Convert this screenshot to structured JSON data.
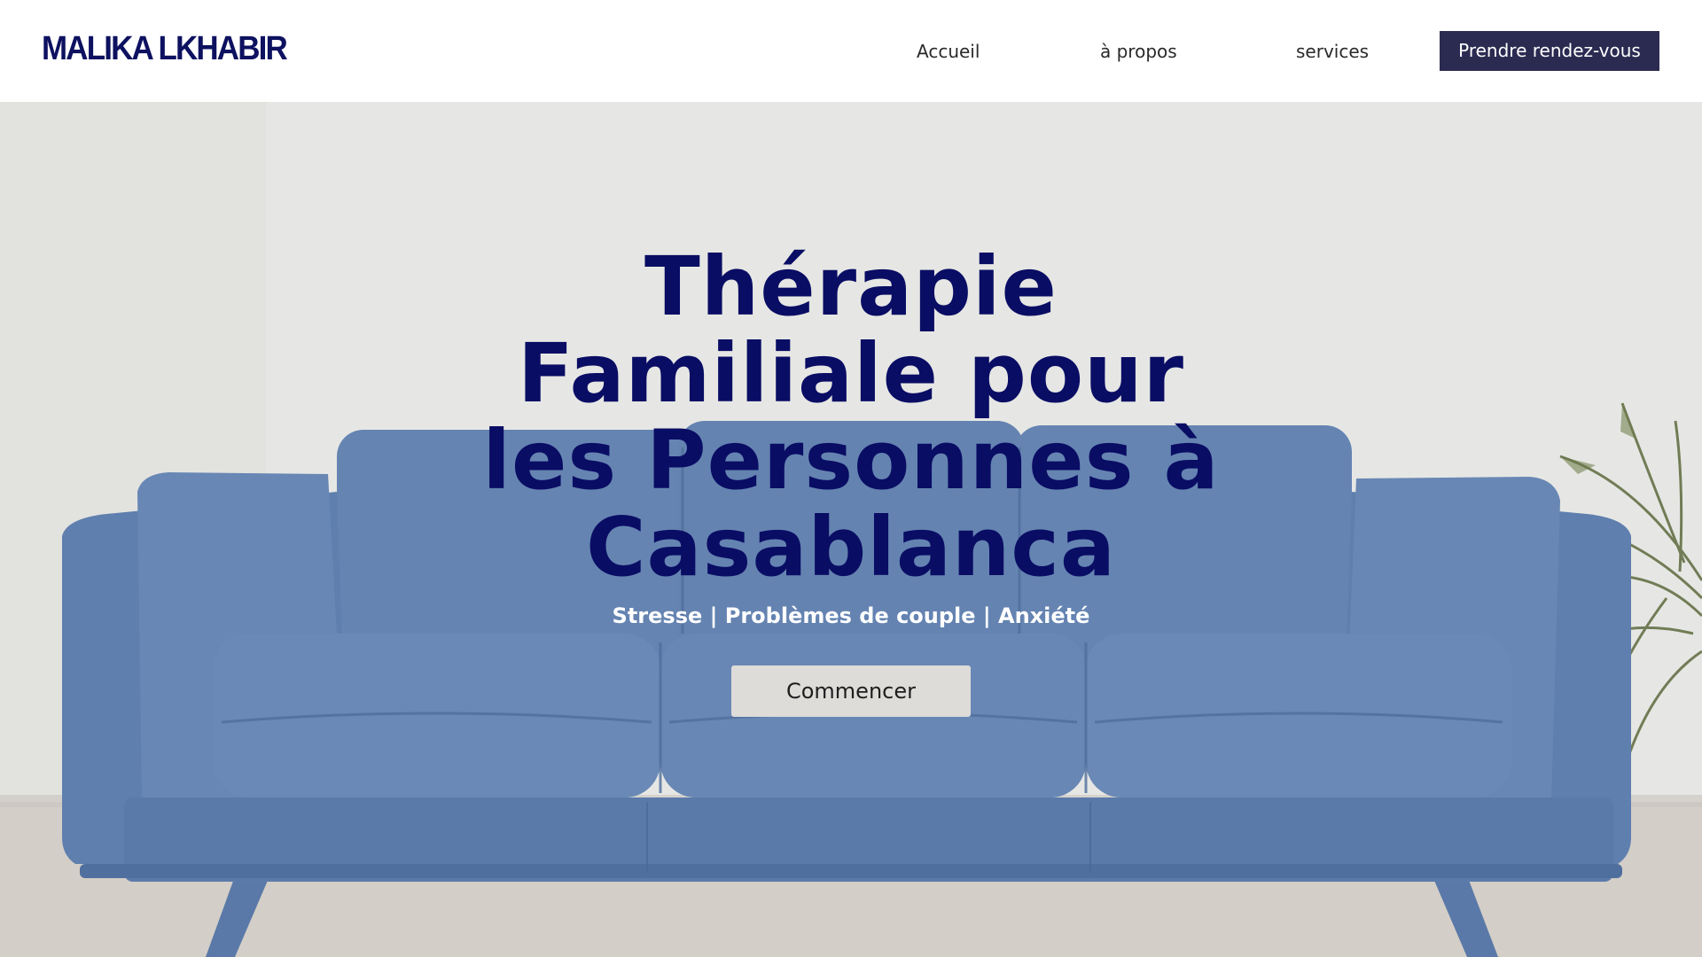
{
  "header": {
    "logo": "MALIKA LKHABIR",
    "nav": {
      "home": "Accueil",
      "about": "à propos",
      "services": "services"
    },
    "cta_label": "Prendre rendez-vous"
  },
  "hero": {
    "title_lines": [
      "Thérapie",
      "Familiale pour",
      "les Personnes à",
      "Casablanca"
    ],
    "subtitle": "Stresse | Problèmes de couple | Anxiété",
    "button_label": "Commencer"
  },
  "colors": {
    "brand_navy": "#0a0d64",
    "cta_background": "#2b2b52",
    "sofa_blue": "#5f80b0",
    "button_background": "#dddcd9"
  }
}
